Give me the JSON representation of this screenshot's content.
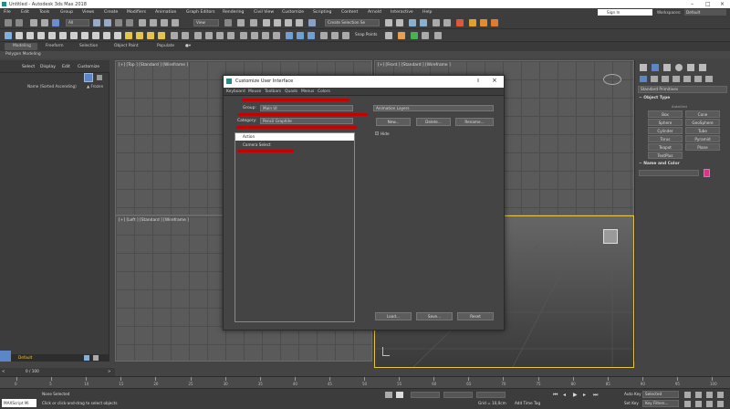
{
  "window": {
    "title": "Untitled - Autodesk 3ds Max 2018",
    "sign_in": "Sign In",
    "workspaces_label": "Workspaces:",
    "workspaces_value": "Default"
  },
  "menu": [
    "File",
    "Edit",
    "Tools",
    "Group",
    "Views",
    "Create",
    "Modifiers",
    "Animation",
    "Graph Editors",
    "Rendering",
    "Civil View",
    "Customize",
    "Scripting",
    "Content",
    "Arnold",
    "Interactive",
    "Help"
  ],
  "toolbar": {
    "filter_value": "All",
    "view_value": "View",
    "create_selection_set": "Create Selection Se",
    "snap_label": "Snap Points"
  },
  "ribbon": {
    "tabs": [
      "Modeling",
      "Freeform",
      "Selection",
      "Object Paint",
      "Populate"
    ],
    "sub": "Polygon Modeling"
  },
  "explorer": {
    "tabs": [
      "Select",
      "Display",
      "Edit",
      "Customize"
    ],
    "header_name": "Name (Sorted Ascending)",
    "header_frozen": "▲ Frozen",
    "footer_value": "Default"
  },
  "viewports": {
    "top": "[+] [Top ] [Standard ] [Wireframe ]",
    "front": "[+] [Front ] [Standard ] [Wireframe ]",
    "left": "[+] [Left ] [Standard ] [Wireframe ]"
  },
  "command_panel": {
    "dropdown": "Standard Primitives",
    "rollout_object_type": "Object Type",
    "autogrid": "AutoGrid",
    "buttons": [
      "Box",
      "Cone",
      "Sphere",
      "GeoSphere",
      "Cylinder",
      "Tube",
      "Torus",
      "Pyramid",
      "Teapot",
      "Plane",
      "TextPlus"
    ],
    "rollout_name_color": "Name and Color",
    "color": "#d6338a"
  },
  "dialog": {
    "title": "Customize User Interface",
    "close": "×",
    "tabs": [
      "Keyboard",
      "Mouse",
      "Toolbars",
      "Quads",
      "Menus",
      "Colors"
    ],
    "group_label": "Group:",
    "group_value": "Main UI",
    "category_label": "Category:",
    "category_value": "Pencil Graphite",
    "list_header": "Action",
    "list_items": [
      "Camera Select"
    ],
    "right_dropdown": "Animation Layers",
    "new_button": "New...",
    "delete_button": "Delete...",
    "rename_button": "Rename...",
    "hide_label": "Hide",
    "load_button": "Load...",
    "save_button": "Save...",
    "reset_button": "Reset"
  },
  "status": {
    "frame_counter": "0 / 100",
    "none_selected": "None Selected",
    "hint": "Click or click-and-drag to select objects",
    "maxscript": "MAXScript Mi",
    "grid": "Grid = 10,0cm",
    "add_time_tag": "Add Time Tag",
    "auto_key": "Auto Key",
    "selected": "Selected",
    "set_key": "Set Key",
    "key_filters": "Key Filters...",
    "timeline_ticks": [
      "0",
      "5",
      "10",
      "15",
      "20",
      "25",
      "30",
      "35",
      "40",
      "45",
      "50",
      "55",
      "60",
      "65",
      "70",
      "75",
      "80",
      "85",
      "90",
      "95",
      "100"
    ]
  }
}
